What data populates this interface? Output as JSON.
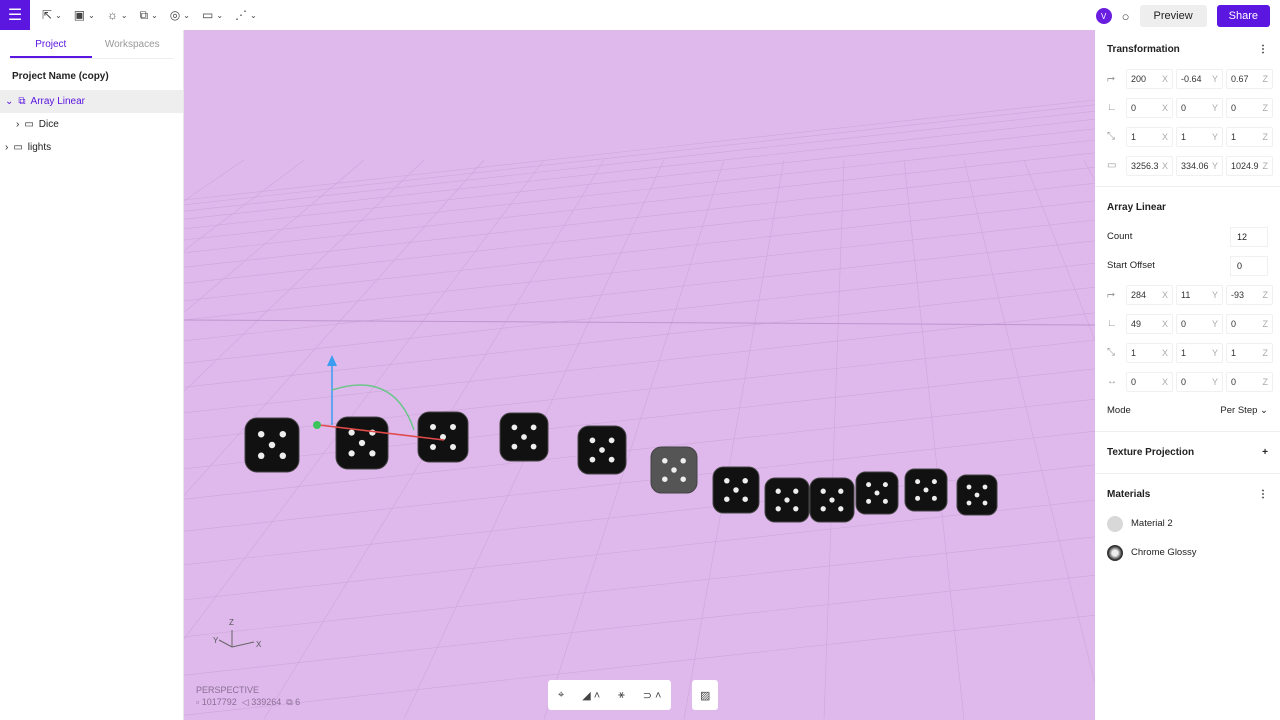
{
  "toolbar": {
    "menu_icon": "hamburger-icon",
    "tools": [
      "select-tool",
      "box-tool",
      "light-tool",
      "array-tool",
      "material-tool",
      "folder-tool",
      "path-tool"
    ],
    "preview": "Preview",
    "share": "Share",
    "avatar": "V"
  },
  "left": {
    "tabs": [
      "Project",
      "Workspaces"
    ],
    "project_name": "Project Name (copy)",
    "tree": [
      {
        "label": "Array Linear"
      },
      {
        "label": "Dice"
      },
      {
        "label": "lights"
      }
    ]
  },
  "viewport": {
    "mode": "PERSPECTIVE",
    "vertices": "1017792",
    "edges": "339264",
    "objects": "6",
    "axes": {
      "z": "Z",
      "y": "Y",
      "x": "X"
    }
  },
  "transformation": {
    "title": "Transformation",
    "rows": [
      [
        "200",
        "-0.64",
        "0.67"
      ],
      [
        "0",
        "0",
        "0"
      ],
      [
        "1",
        "1",
        "1"
      ],
      [
        "3256.3",
        "334.06",
        "1024.9"
      ]
    ]
  },
  "array": {
    "title": "Array Linear",
    "count_label": "Count",
    "count": "12",
    "offset_label": "Start Offset",
    "offset": "0",
    "rows": [
      [
        "284",
        "11",
        "-93"
      ],
      [
        "49",
        "0",
        "0"
      ],
      [
        "1",
        "1",
        "1"
      ],
      [
        "0",
        "0",
        "0"
      ]
    ],
    "mode_label": "Mode",
    "mode": "Per Step"
  },
  "texture": {
    "title": "Texture Projection"
  },
  "materials": {
    "title": "Materials",
    "items": [
      {
        "name": "Material 2",
        "color": "#d8d8d8"
      },
      {
        "name": "Chrome Glossy",
        "color": "#444444"
      }
    ]
  },
  "colors": {
    "accent": "#5b16e0",
    "viewport": "#dfb8ec"
  }
}
